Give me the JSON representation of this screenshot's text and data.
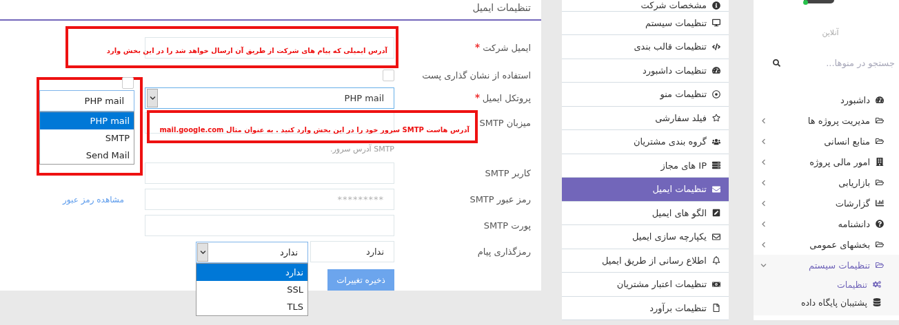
{
  "panel_title": "تنظیمات ایمیل",
  "fields": [
    {
      "kind": "text",
      "label": "ایمیل شرکت",
      "required": true
    },
    {
      "kind": "checkbox",
      "label": "استفاده از نشان گذاری پست",
      "checked": false
    },
    {
      "kind": "select",
      "label": "پروتکل ایمیل",
      "required": true,
      "value": "PHP mail"
    },
    {
      "kind": "text",
      "label": "میزبان SMTP",
      "hint": "SMTP آدرس سرور."
    },
    {
      "kind": "text",
      "label": "کاربر SMTP"
    },
    {
      "kind": "password",
      "label": "رمز عبور SMTP",
      "placeholder": "*********",
      "link": "مشاهده رمز عبور"
    },
    {
      "kind": "text",
      "label": "پورت SMTP"
    },
    {
      "kind": "value",
      "label": "رمزگذاری پیام",
      "value": "ندارد"
    }
  ],
  "save_button": "ذخیره تغییرات",
  "annotations": [
    "آدرس ایمیلی که پیام های شرکت از طریق آن ارسال خواهد شد را در این بخش وارد",
    "آدرس هاست **SMTP** سرور خود را در این بخش وارد کنید . به عنوان مثال **mail.google.com**"
  ],
  "protocol_popup": {
    "checked": false,
    "value": "PHP mail",
    "options": [
      {
        "label": "PHP mail",
        "selected": true
      },
      {
        "label": "SMTP",
        "selected": false
      },
      {
        "label": "Send Mail",
        "selected": false
      }
    ]
  },
  "encryption_dropdown": {
    "value": "ندارد",
    "options": [
      {
        "label": "ندارد",
        "selected": true
      },
      {
        "label": "SSL",
        "selected": false
      },
      {
        "label": "TLS",
        "selected": false
      }
    ]
  },
  "settings_menu": [
    {
      "label": "مشخصات شرکت",
      "selected": false
    },
    {
      "label": "تنظیمات سیستم",
      "selected": false
    },
    {
      "label": "تنظیمات قالب بندی",
      "selected": false
    },
    {
      "label": "تنظیمات داشبورد",
      "selected": false
    },
    {
      "label": "تنظیمات منو",
      "selected": false
    },
    {
      "label": "فیلد سفارشی",
      "selected": false
    },
    {
      "label": "گروه بندی مشتریان",
      "selected": false
    },
    {
      "label": "IP های مجاز",
      "selected": false
    },
    {
      "label": "تنظیمات ایمیل",
      "selected": true
    },
    {
      "label": "الگو های ایمیل",
      "selected": false
    },
    {
      "label": "یکپارچه سازی ایمیل",
      "selected": false
    },
    {
      "label": "اطلاع رسانی از طریق ایمیل",
      "selected": false
    },
    {
      "label": "تنظیمات اعتبار مشتریان",
      "selected": false
    },
    {
      "label": "تنظیمات برآورد",
      "selected": false
    }
  ],
  "sidebar": {
    "status": "آنلاین",
    "search_placeholder": "جستجو در منوها...",
    "items": [
      {
        "kind": "link",
        "label": "داشبورد"
      },
      {
        "kind": "group",
        "label": "مدیریت پروژه ها",
        "expanded": false
      },
      {
        "kind": "group",
        "label": "منابع انسانی",
        "expanded": false
      },
      {
        "kind": "group",
        "label": "امور مالی پروژه",
        "expanded": false
      },
      {
        "kind": "group",
        "label": "بازاریابی",
        "expanded": false
      },
      {
        "kind": "group",
        "label": "گزارشات",
        "expanded": false
      },
      {
        "kind": "group",
        "label": "دانشنامه",
        "expanded": false
      },
      {
        "kind": "group",
        "label": "بخشهای عمومی",
        "expanded": false
      },
      {
        "kind": "group",
        "label": "تنظیمات سیستم",
        "expanded": true,
        "children": [
          {
            "label": "تنظیمات",
            "selected": true
          },
          {
            "label": "پشتیبان پایگاه داده",
            "selected": false
          }
        ]
      }
    ]
  }
}
